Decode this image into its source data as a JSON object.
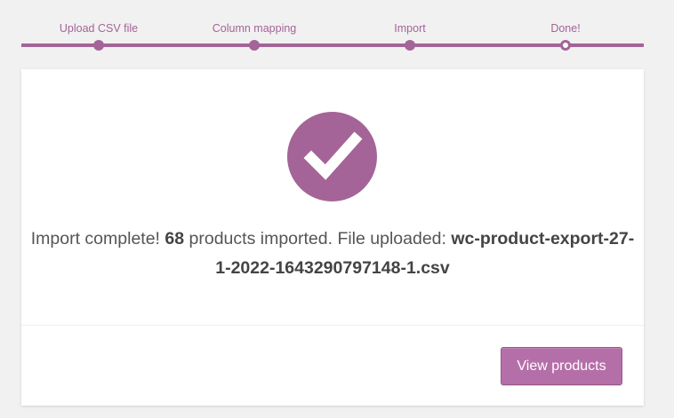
{
  "steps": [
    {
      "label": "Upload CSV file",
      "state": "done"
    },
    {
      "label": "Column mapping",
      "state": "done"
    },
    {
      "label": "Import",
      "state": "done"
    },
    {
      "label": "Done!",
      "state": "active"
    }
  ],
  "colors": {
    "accent": "#a46497",
    "button": "#b56fa8",
    "background": "#f1f1f1",
    "card": "#ffffff"
  },
  "result": {
    "icon": "checkmark-icon",
    "prefix": "Import complete!",
    "count": "68",
    "middle": "products imported. File uploaded:",
    "filename": "wc-product-export-27-1-2022-1643290797148-1.csv"
  },
  "actions": {
    "view_products_label": "View products"
  }
}
